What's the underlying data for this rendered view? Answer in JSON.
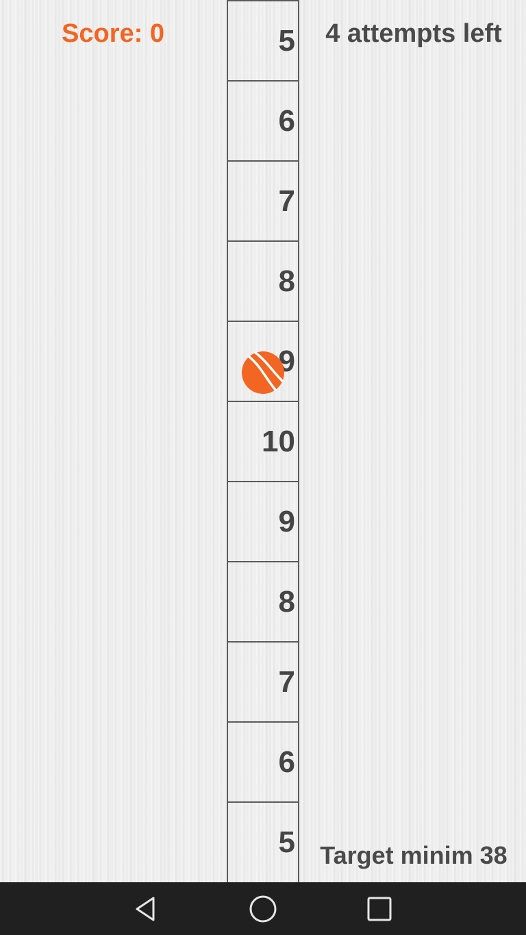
{
  "header": {
    "score_text": "Score: 0",
    "attempts_text": "4 attempts left"
  },
  "footer": {
    "target_text": "Target minim 38"
  },
  "ladder": {
    "cells": [
      "5",
      "6",
      "7",
      "8",
      "9",
      "10",
      "9",
      "8",
      "7",
      "6",
      "5"
    ],
    "ball_cell_index": 4
  },
  "ball": {
    "icon": "tennis-ball-icon",
    "color": "#f26522"
  },
  "colors": {
    "score": "#f26522",
    "text": "#4a4a4a",
    "navbar": "#202020"
  },
  "navbar": {
    "buttons": [
      {
        "icon": "back-triangle-icon"
      },
      {
        "icon": "home-circle-icon"
      },
      {
        "icon": "recents-square-icon"
      }
    ]
  }
}
